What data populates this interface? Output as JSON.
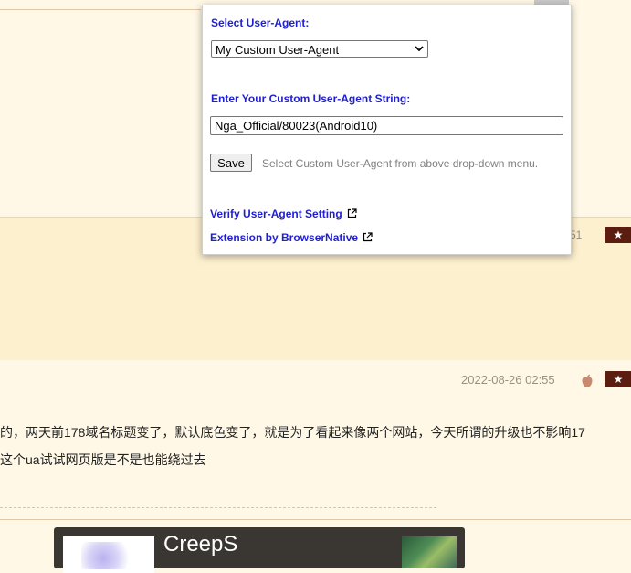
{
  "popup": {
    "select_label": "Select User-Agent:",
    "selected_option": "My Custom User-Agent",
    "custom_label": "Enter Your Custom User-Agent String:",
    "custom_value": "Nga_Official/80023(Android10)",
    "save_label": "Save",
    "hint": "Select Custom User-Agent from above drop-down menu.",
    "verify_link": "Verify User-Agent Setting",
    "credit_link": "Extension by BrowserNative"
  },
  "page": {
    "post1_timestamp_fragment": "51",
    "post2_timestamp": "2022-08-26 02:55",
    "star_label": "★",
    "post2_line1": "的，两天前178域名标题变了，默认底色变了，就是为了看起来像两个网站，今天所谓的升级也不影响17",
    "post2_line2": "这个ua试试网页版是不是也能绕过去",
    "card_name": "CreepS"
  },
  "icons": {
    "external": "external-link-icon",
    "apple": "apple-icon",
    "chevron": "chevron-down-icon",
    "star": "star-icon"
  },
  "colors": {
    "page_bg": "#fff8e7",
    "post_highlight_bg": "#fdf0cf",
    "popup_label": "#1f1fd1",
    "star_bg": "#5a1d10"
  }
}
